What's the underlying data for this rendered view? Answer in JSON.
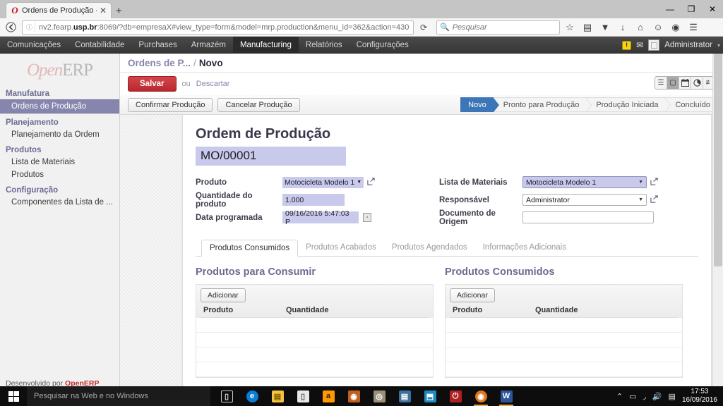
{
  "browser": {
    "tab_title": "Ordens de Produção - Op...",
    "tab_close": "✕",
    "new_tab": "+",
    "back": "←",
    "url_prefix": "nv2.fearp.",
    "url_domain": "usp.br",
    "url_suffix": ":8069/?db=empresaX#view_type=form&model=mrp.production&menu_id=362&action=430",
    "url_info_icon": "ⓘ",
    "reload_icon": "⟳",
    "search_placeholder": "Pesquisar",
    "search_value": "",
    "window_minimize": "—",
    "window_maximize": "❐",
    "window_close": "✕",
    "toolbar_icons": [
      "star-icon",
      "reading-list-icon",
      "pocket-icon",
      "downloads-icon",
      "home-icon",
      "smiley-icon",
      "sync-icon",
      "hamburger-menu-icon"
    ]
  },
  "topmenu": {
    "items": [
      {
        "label": "Comunicações",
        "active": false
      },
      {
        "label": "Contabilidade",
        "active": false
      },
      {
        "label": "Purchases",
        "active": false
      },
      {
        "label": "Armazém",
        "active": false
      },
      {
        "label": "Manufacturing",
        "active": true
      },
      {
        "label": "Relatórios",
        "active": false
      },
      {
        "label": "Configurações",
        "active": false
      }
    ],
    "warning_badge": "!",
    "username": "Administrator",
    "caret": "▾"
  },
  "sidebar": {
    "logo_open": "Open",
    "logo_erp": "ERP",
    "groups": [
      {
        "title": "Manufatura",
        "items": [
          {
            "label": "Ordens de Produção",
            "active": true
          }
        ]
      },
      {
        "title": "Planejamento",
        "items": [
          {
            "label": "Planejamento da Ordem",
            "active": false
          }
        ]
      },
      {
        "title": "Produtos",
        "items": [
          {
            "label": "Lista de Materiais",
            "active": false
          },
          {
            "label": "Produtos",
            "active": false
          }
        ]
      },
      {
        "title": "Configuração",
        "items": [
          {
            "label": "Componentes da Lista de ...",
            "active": false
          }
        ]
      }
    ],
    "credit_prefix": "Desenvolvido por ",
    "credit_brand": "OpenERP"
  },
  "breadcrumb": {
    "parent": "Ordens de P...",
    "separator": "/",
    "current": "Novo"
  },
  "savebar": {
    "save_label": "Salvar",
    "or_label": "ou",
    "discard_label": "Descartar"
  },
  "viewswitch": [
    {
      "icon": "list-view-icon",
      "glyph": "☰",
      "active": false
    },
    {
      "icon": "form-view-icon",
      "glyph": "▢",
      "active": true
    },
    {
      "icon": "calendar-view-icon",
      "glyph": "🗓",
      "active": false
    },
    {
      "icon": "graph-view-icon",
      "glyph": "◕",
      "active": false
    },
    {
      "icon": "gantt-view-icon",
      "glyph": "≢",
      "active": false
    }
  ],
  "actionbar": {
    "confirm_label": "Confirmar Produção",
    "cancel_label": "Cancelar Produção"
  },
  "statusbar": [
    {
      "label": "Novo",
      "active": true
    },
    {
      "label": "Pronto para Produção",
      "active": false
    },
    {
      "label": "Produção Iniciada",
      "active": false
    },
    {
      "label": "Concluído",
      "active": false
    }
  ],
  "form": {
    "title": "Ordem de Produção",
    "record_name": "MO/00001",
    "left_fields": [
      {
        "label": "Produto",
        "value": "Motocicleta Modelo 1",
        "type": "selection",
        "has_link": true
      },
      {
        "label": "Quantidade do produto",
        "value": "1.000",
        "type": "text",
        "has_link": false
      },
      {
        "label": "Data programada",
        "value": "09/16/2016 5:47:03 P",
        "type": "datetime",
        "has_link": false
      }
    ],
    "right_fields": [
      {
        "label": "Lista de Materiais",
        "value": "Motocicleta Modelo 1",
        "type": "select",
        "has_link": true
      },
      {
        "label": "Responsável",
        "value": "Administrator",
        "type": "select",
        "has_link": true
      },
      {
        "label": "Documento de Origem",
        "value": "",
        "type": "text",
        "has_link": false
      }
    ],
    "calendar_icon": "▫"
  },
  "notebook": {
    "tabs": [
      {
        "label": "Produtos Consumidos",
        "active": true
      },
      {
        "label": "Produtos Acabados",
        "active": false
      },
      {
        "label": "Produtos Agendados",
        "active": false
      },
      {
        "label": "Informações Adicionais",
        "active": false
      }
    ]
  },
  "panes": [
    {
      "title": "Produtos para Consumir",
      "add_label": "Adicionar",
      "columns": [
        "Produto",
        "Quantidade"
      ],
      "rows": []
    },
    {
      "title": "Produtos Consumidos",
      "add_label": "Adicionar",
      "columns": [
        "Produto",
        "Quantidade"
      ],
      "rows": []
    }
  ],
  "taskbar": {
    "search_placeholder": "Pesquisar na Web e no Windows",
    "task_view_icon": "▯",
    "apps": [
      {
        "name": "edge",
        "glyph": "e",
        "color": "#0a7fd4",
        "open": false
      },
      {
        "name": "file-explorer",
        "glyph": "▤",
        "color": "#f5c242",
        "open": false
      },
      {
        "name": "store",
        "glyph": "▯",
        "color": "#dcdcdc",
        "open": false
      },
      {
        "name": "amazon",
        "glyph": "a",
        "color": "#ff9900",
        "open": false
      },
      {
        "name": "app-orange",
        "glyph": "◉",
        "color": "#c06020",
        "open": false
      },
      {
        "name": "app-gray",
        "glyph": "◎",
        "color": "#9b8f7a",
        "open": false
      },
      {
        "name": "app-photo",
        "glyph": "▤",
        "color": "#3b6f9e",
        "open": false
      },
      {
        "name": "teamviewer",
        "glyph": "⬒",
        "color": "#1e8bc3",
        "open": false
      },
      {
        "name": "shutdown",
        "glyph": "⏻",
        "color": "#b02020",
        "open": false
      },
      {
        "name": "firefox",
        "glyph": "◉",
        "color": "#e2761b",
        "open": true
      },
      {
        "name": "word",
        "glyph": "W",
        "color": "#2b579a",
        "open": true
      }
    ],
    "tray_icons": [
      "chevron-up-icon",
      "battery-icon",
      "wifi-icon",
      "volume-icon",
      "action-center-icon"
    ],
    "clock_time": "17:53",
    "clock_date": "16/09/2016"
  }
}
